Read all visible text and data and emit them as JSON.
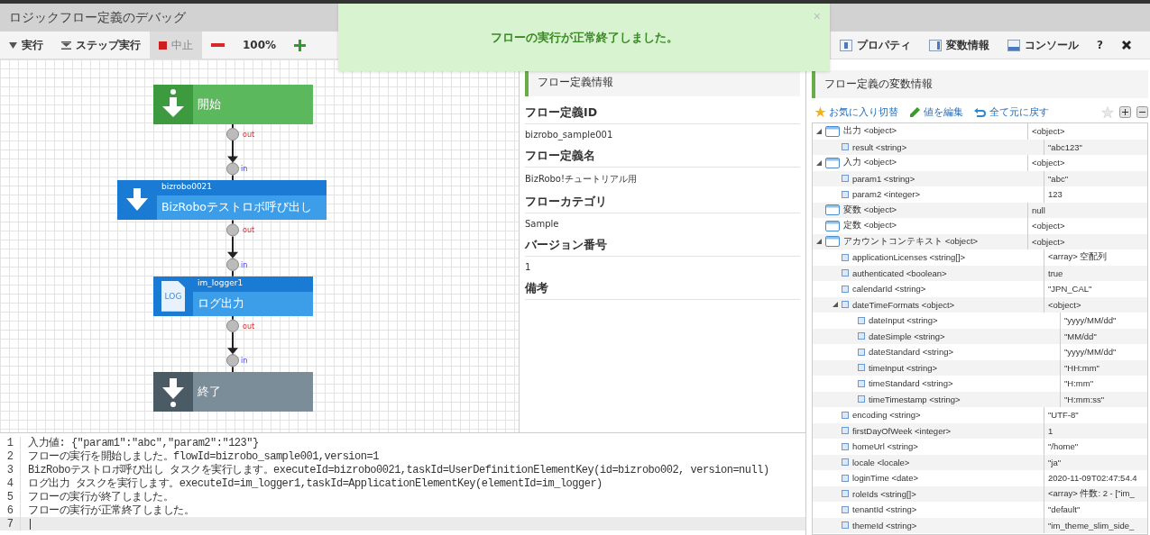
{
  "window": {
    "title": "ロジックフロー定義のデバッグ"
  },
  "toolbar": {
    "left": [
      {
        "kind": "run",
        "label": "実行",
        "disabled": false
      },
      {
        "kind": "step",
        "label": "ステップ実行",
        "disabled": false
      },
      {
        "kind": "stop",
        "label": "中止",
        "disabled": true
      },
      {
        "kind": "zoom-out",
        "disabled": false
      },
      {
        "kind": "zoom",
        "label": "100%",
        "disabled": false
      },
      {
        "kind": "zoom-in",
        "disabled": false
      }
    ],
    "right": [
      {
        "kind": "properties",
        "label": "プロパティ"
      },
      {
        "kind": "variables",
        "label": "変数情報"
      },
      {
        "kind": "console",
        "label": "コンソール"
      },
      {
        "kind": "help",
        "label": "?"
      },
      {
        "kind": "close"
      }
    ]
  },
  "toast": {
    "message": "フローの実行が正常終了しました。",
    "close": "×"
  },
  "flow": {
    "nodes": [
      {
        "kind": "start",
        "name": "開始",
        "out": "out"
      },
      {
        "kind": "robot",
        "id": "bizrobo0021",
        "name": "BizRoboテストロボ呼び出し",
        "in": "in",
        "out": "out"
      },
      {
        "kind": "log",
        "id": "im_logger1",
        "name": "ログ出力",
        "icon_text": "LOG",
        "in": "in",
        "out": "out"
      },
      {
        "kind": "end",
        "name": "終了",
        "in": "in"
      }
    ]
  },
  "properties": {
    "title": "フロー定義情報",
    "fields": [
      {
        "label": "フロー定義ID",
        "value": "bizrobo_sample001"
      },
      {
        "label": "フロー定義名",
        "value": "BizRobo!チュートリアル用"
      },
      {
        "label": "フローカテゴリ",
        "value": "Sample"
      },
      {
        "label": "バージョン番号",
        "value": "1"
      },
      {
        "label": "備考"
      }
    ]
  },
  "variables": {
    "title": "フロー定義の変数情報",
    "actions": [
      {
        "kind": "favorite",
        "label": "お気に入り切替"
      },
      {
        "kind": "edit",
        "label": "値を編集"
      },
      {
        "kind": "revert",
        "label": "全て元に戻す"
      }
    ],
    "rows": [
      {
        "kind": "object",
        "label": "出力 <object>",
        "value": "<object>",
        "expanded": true,
        "children": [
          {
            "kind": "field",
            "label": "result <string>",
            "value": "\"abc123\""
          }
        ]
      },
      {
        "kind": "object",
        "label": "入力 <object>",
        "value": "<object>",
        "expanded": true,
        "children": [
          {
            "kind": "field",
            "label": "param1 <string>",
            "value": "\"abc\""
          },
          {
            "kind": "field",
            "label": "param2 <integer>",
            "value": "123"
          }
        ]
      },
      {
        "kind": "object",
        "label": "変数 <object>",
        "value": "null"
      },
      {
        "kind": "object",
        "label": "定数 <object>",
        "value": "<object>"
      },
      {
        "kind": "object",
        "label": "アカウントコンテキスト <object>",
        "value": "<object>",
        "expanded": true,
        "children": [
          {
            "kind": "field",
            "label": "applicationLicenses <string[]>",
            "value": "<array> 空配列"
          },
          {
            "kind": "field",
            "label": "authenticated <boolean>",
            "value": "true"
          },
          {
            "kind": "field",
            "label": "calendarId <string>",
            "value": "\"JPN_CAL\""
          },
          {
            "kind": "field",
            "label": "dateTimeFormats <object>",
            "value": "<object>",
            "expanded": true,
            "children": [
              {
                "kind": "field",
                "label": "dateInput <string>",
                "value": "\"yyyy/MM/dd\""
              },
              {
                "kind": "field",
                "label": "dateSimple <string>",
                "value": "\"MM/dd\""
              },
              {
                "kind": "field",
                "label": "dateStandard <string>",
                "value": "\"yyyy/MM/dd\""
              },
              {
                "kind": "field",
                "label": "timeInput <string>",
                "value": "\"HH:mm\""
              },
              {
                "kind": "field",
                "label": "timeStandard <string>",
                "value": "\"H:mm\""
              },
              {
                "kind": "field",
                "label": "timeTimestamp <string>",
                "value": "\"H:mm:ss\""
              }
            ]
          },
          {
            "kind": "field",
            "label": "encoding <string>",
            "value": "\"UTF-8\""
          },
          {
            "kind": "field",
            "label": "firstDayOfWeek <integer>",
            "value": "1"
          },
          {
            "kind": "field",
            "label": "homeUrl <string>",
            "value": "\"/home\""
          },
          {
            "kind": "field",
            "label": "locale <locale>",
            "value": "\"ja\""
          },
          {
            "kind": "field",
            "label": "loginTime <date>",
            "value": "2020-11-09T02:47:54.4"
          },
          {
            "kind": "field",
            "label": "roleIds <string[]>",
            "value": "<array> 件数: 2 - [\"im_"
          },
          {
            "kind": "field",
            "label": "tenantId <string>",
            "value": "\"default\""
          },
          {
            "kind": "field",
            "label": "themeId <string>",
            "value": "\"im_theme_slim_side_"
          }
        ]
      }
    ]
  },
  "console": {
    "lines": [
      {
        "number": "1",
        "text": "入力値: {\"param1\":\"abc\",\"param2\":\"123\"}",
        "selected": false
      },
      {
        "number": "2",
        "text": "フローの実行を開始しました。flowId=bizrobo_sample001,version=1",
        "selected": false
      },
      {
        "number": "3",
        "text": "BizRoboテストロボ呼び出し タスクを実行します。executeId=bizrobo0021,taskId=UserDefinitionElementKey(id=bizrobo002, version=null)",
        "selected": false
      },
      {
        "number": "4",
        "text": "ログ出力 タスクを実行します。executeId=im_logger1,taskId=ApplicationElementKey(elementId=im_logger)",
        "selected": false
      },
      {
        "number": "5",
        "text": "フローの実行が終了しました。",
        "selected": false
      },
      {
        "number": "6",
        "text": "フローの実行が正常終了しました。",
        "selected": false
      },
      {
        "number": "7",
        "selected": true
      }
    ]
  }
}
